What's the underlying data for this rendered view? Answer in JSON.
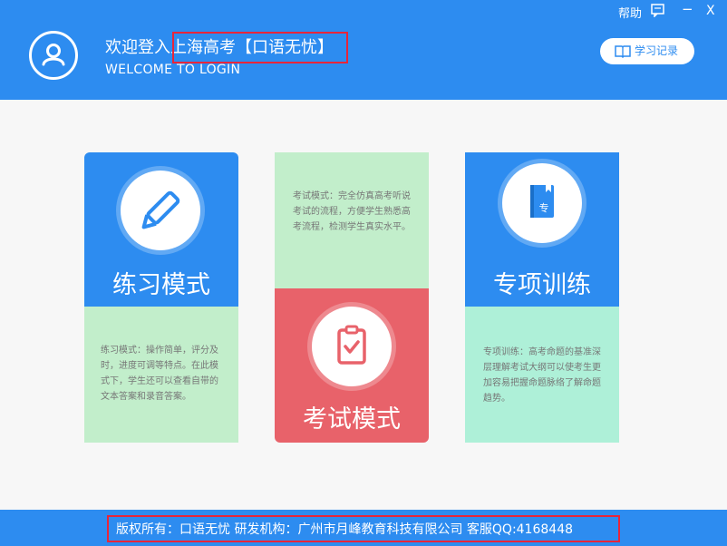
{
  "window_controls": {
    "help": "帮助",
    "minimize": "−",
    "close": "X"
  },
  "header": {
    "title": "欢迎登入上海高考【口语无忧】",
    "subtitle": "WELCOME TO LOGIN",
    "records_button": "学习记录"
  },
  "modes": {
    "practice": {
      "title": "练习模式",
      "desc": "练习模式：操作简单，评分及时，进度可调等特点。在此模式下，学生还可以查看自带的文本答案和录音答案。"
    },
    "exam": {
      "title": "考试模式",
      "desc": "考试模式：完全仿真高考听说考试的流程，方便学生熟悉高考流程，检测学生真实水平。"
    },
    "special": {
      "title": "专项训练",
      "desc": "专项训练：高考命题的基准深层理解考试大纲可以使考生更加容易把握命题脉络了解命题趋势。",
      "book_char": "专"
    }
  },
  "footer": {
    "text": "版权所有：口语无忧  研发机构：广州市月峰教育科技有限公司  客服QQ:4168448"
  },
  "colors": {
    "primary": "#2d8cf0",
    "highlight": "#e8253a",
    "green_light": "#c2eecb",
    "red": "#e8626a",
    "teal_light": "#aef0d8"
  }
}
